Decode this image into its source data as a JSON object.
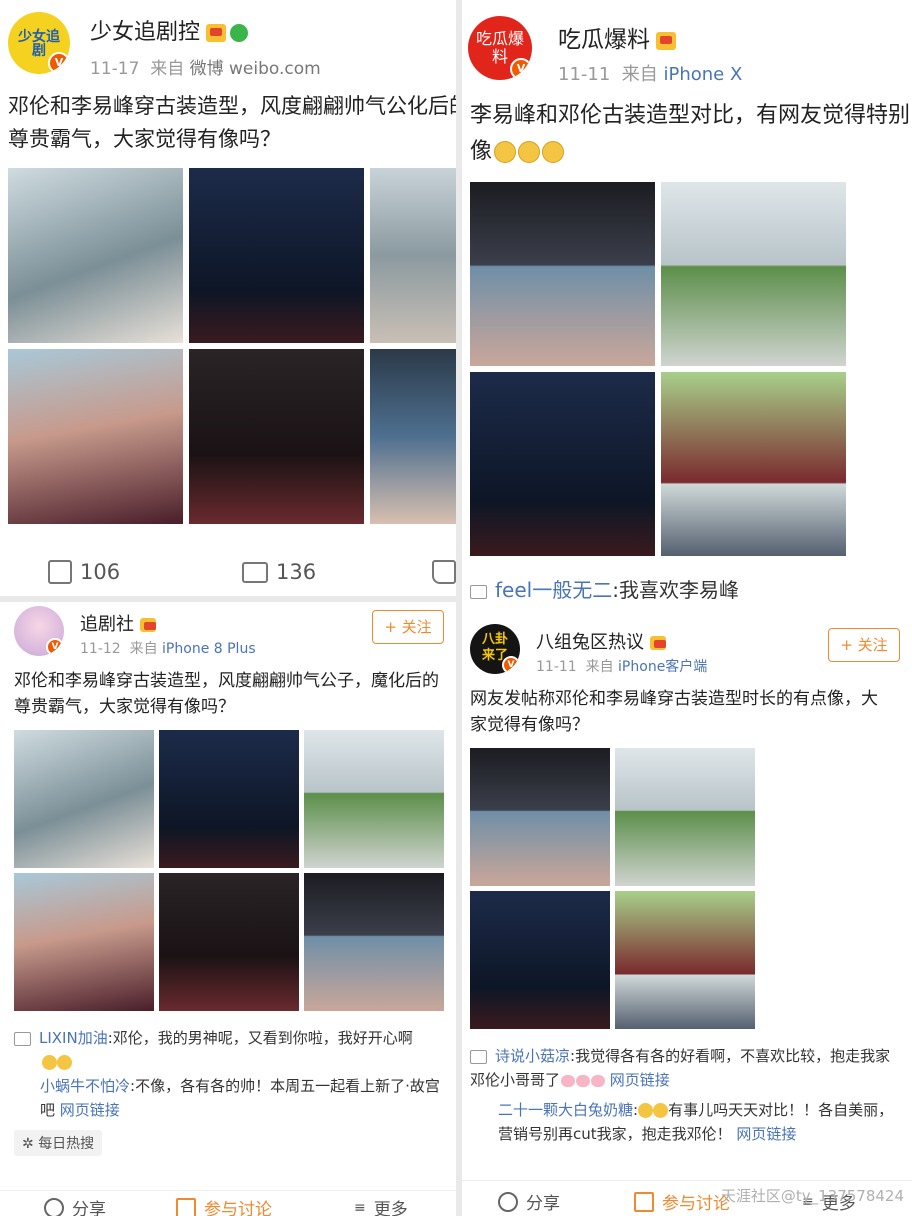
{
  "post1": {
    "username": "少女追剧控",
    "avatar_text": "少女追剧",
    "date": "11-17",
    "from_label": "来自",
    "source": "微博 weibo.com",
    "text": "邓伦和李易峰穿古装造型，风度翩翩帅气公化后的尊贵霸气，大家觉得有像吗？",
    "share_count": "106",
    "comment_count": "136"
  },
  "post2": {
    "username": "吃瓜爆料",
    "avatar_text": "吃瓜爆料",
    "date": "11-11",
    "from_label": "来自",
    "source": "iPhone X",
    "text": "李易峰和邓伦古装造型对比，有网友觉得特别像",
    "comment_user": "feel一般无二",
    "comment_text": ":我喜欢李易峰"
  },
  "post3": {
    "username": "追剧社",
    "date": "11-12",
    "from_label": "来自",
    "source": "iPhone 8 Plus",
    "follow_label": "关注",
    "text": "邓伦和李易峰穿古装造型，风度翩翩帅气公子，魔化后的尊贵霸气，大家觉得有像吗？",
    "comments": [
      {
        "user": "LIXIN加油",
        "text": ":邓伦，我的男神呢，又看到你啦，我好开心啊"
      },
      {
        "user": "小蜗牛不怕冷",
        "text": ":不像，各有各的帅！本周五一起看上新了·故宫吧",
        "link": "网页链接"
      }
    ],
    "hot_tag": "每日热搜"
  },
  "post4": {
    "username": "八组兔区热议",
    "avatar_text": "八卦来了",
    "date": "11-11",
    "from_label": "来自",
    "source": "iPhone客户端",
    "follow_label": "关注",
    "text": "网友发帖称邓伦和李易峰穿古装造型时长的有点像，大家觉得有像吗？",
    "comments": [
      {
        "user": "诗说小菇凉",
        "text": ":我觉得各有各的好看啊，不喜欢比较，抱走我家邓伦小哥哥了",
        "link": "网页链接"
      },
      {
        "user": "二十一颗大白兔奶糖",
        "text": "有事儿吗天天对比！！各自美丽，营销号别再cut我家，抱走我邓伦！",
        "link": "网页链接"
      }
    ]
  },
  "bottom_bar": {
    "share": "分享",
    "discuss": "参与讨论",
    "more": "更多"
  },
  "watermark": "天涯社区@ty_137578424",
  "colors": {
    "link_blue": "#4a74b8",
    "accent_orange": "#f08a30"
  }
}
